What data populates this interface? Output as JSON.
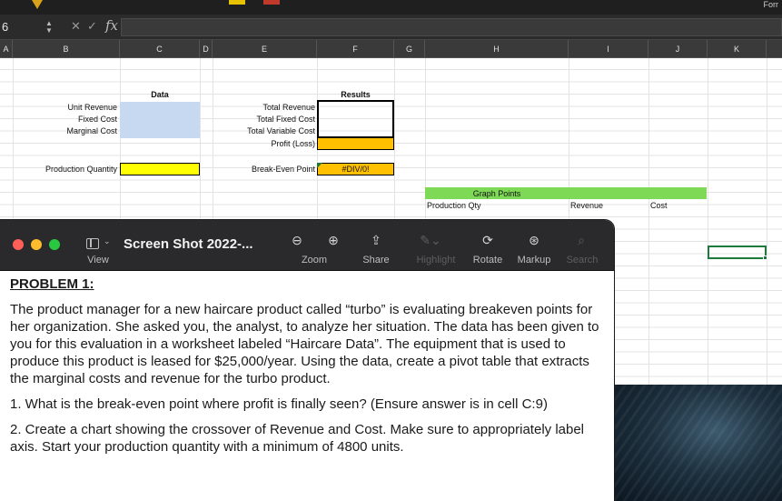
{
  "excel": {
    "top_right_label": "Forr",
    "name_box": "6",
    "formula_label": "fx",
    "columns": [
      "A",
      "B",
      "C",
      "D",
      "E",
      "F",
      "G",
      "H",
      "I",
      "J",
      "K"
    ],
    "cells": {
      "data_header": "Data",
      "results_header": "Results",
      "unit_revenue": "Unit Revenue",
      "fixed_cost": "Fixed Cost",
      "marginal_cost": "Marginal Cost",
      "production_quantity": "Production Quantity",
      "total_revenue": "Total Revenue",
      "total_fixed_cost": "Total Fixed Cost",
      "total_variable_cost": "Total Variable Cost",
      "profit_loss": "Profit (Loss)",
      "break_even_point": "Break-Even Point",
      "break_even_value": "#DIV/0!",
      "graph_points": "Graph Points",
      "production_qty": "Production Qty",
      "revenue": "Revenue",
      "cost": "Cost"
    },
    "colors": {
      "input_blue": "#c6d9f1",
      "input_yellow": "#ffff00",
      "result_orange": "#ffc000",
      "graph_green": "#7ed957"
    }
  },
  "preview": {
    "title": "Screen Shot 2022-...",
    "toolbar": {
      "view": "View",
      "zoom": "Zoom",
      "share": "Share",
      "highlight": "Highlight",
      "rotate": "Rotate",
      "markup": "Markup",
      "search": "Search"
    },
    "icons": [
      "sidebar-icon",
      "zoom-out-icon",
      "zoom-in-icon",
      "share-icon",
      "highlight-icon",
      "rotate-icon",
      "markup-icon",
      "search-icon"
    ],
    "document": {
      "heading": "PROBLEM 1:",
      "paragraph": "The product manager for a new haircare product called “turbo” is evaluating breakeven points for her organization. She asked you, the analyst, to analyze her situation. The data has been given to you for this evaluation in a worksheet labeled “Haircare Data”. The equipment that is used to produce this product is leased for $25,000/year. Using the data, create a pivot table that extracts the marginal costs and revenue for the turbo product.",
      "question1": "1. What is the break-even point where profit is finally seen? (Ensure answer is in cell C:9)",
      "question2": "2. Create a chart showing the crossover of Revenue and Cost. Make sure to appropriately label axis. Start your production quantity with a minimum of 4800 units."
    }
  }
}
